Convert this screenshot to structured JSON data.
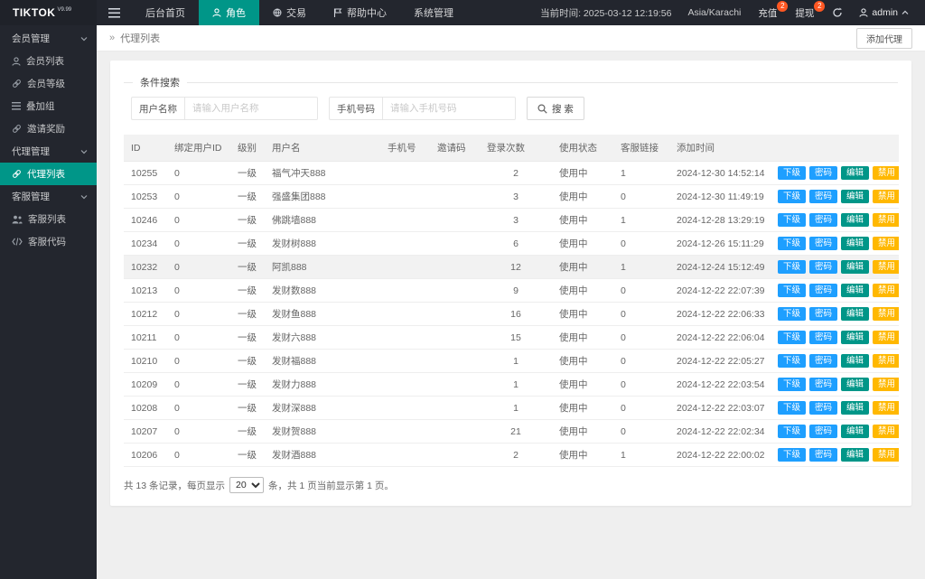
{
  "topbar": {
    "logo": "TIKTOK",
    "logo_version": "V9.99",
    "nav": [
      {
        "label": "后台首页"
      },
      {
        "label": "角色",
        "active": true
      },
      {
        "label": "交易"
      },
      {
        "label": "帮助中心"
      },
      {
        "label": "系统管理"
      }
    ],
    "time_label": "当前时间: 2025-03-12 12:19:56",
    "timezone": "Asia/Karachi",
    "recharge_label": "充值",
    "recharge_badge": "2",
    "withdraw_label": "提现",
    "withdraw_badge": "2",
    "username": "admin"
  },
  "sidebar": {
    "groups": [
      {
        "label": "会员管理",
        "items": [
          {
            "label": "会员列表",
            "icon": "person-icon"
          },
          {
            "label": "会员等级",
            "icon": "link-icon"
          },
          {
            "label": "叠加组",
            "icon": "list-icon"
          },
          {
            "label": "邀请奖励",
            "icon": "link-icon"
          }
        ]
      },
      {
        "label": "代理管理",
        "items": [
          {
            "label": "代理列表",
            "icon": "link-icon",
            "active": true
          }
        ]
      },
      {
        "label": "客服管理",
        "items": [
          {
            "label": "客服列表",
            "icon": "people-icon"
          },
          {
            "label": "客服代码",
            "icon": "code-icon"
          }
        ]
      }
    ]
  },
  "breadcrumb": {
    "separator": "»",
    "label": "代理列表"
  },
  "toolbar": {
    "add_button": "添加代理"
  },
  "search": {
    "legend": "条件搜索",
    "username_label": "用户名称",
    "username_placeholder": "请输入用户名称",
    "phone_label": "手机号码",
    "phone_placeholder": "请输入手机号码",
    "search_button": "搜 索"
  },
  "table": {
    "headers": [
      "ID",
      "绑定用户ID",
      "级别",
      "用户名",
      "手机号",
      "邀请码",
      "登录次数",
      "使用状态",
      "客服链接",
      "添加时间",
      ""
    ],
    "actions": [
      {
        "label": "下级",
        "name": "sublevel-button",
        "color": "#1E9FFF"
      },
      {
        "label": "密码",
        "name": "password-button",
        "color": "#1E9FFF"
      },
      {
        "label": "编辑",
        "name": "edit-button",
        "color": "#009688"
      },
      {
        "label": "禁用",
        "name": "disable-button",
        "color": "#FFB800"
      }
    ],
    "rows": [
      {
        "id": "10255",
        "bind_id": "0",
        "level": "一级",
        "username": "福气冲天888",
        "phone": "",
        "invite_code": "",
        "logins": "2",
        "status": "使用中",
        "cs_link": "1",
        "added": "2024-12-30 14:52:14",
        "highlight": false
      },
      {
        "id": "10253",
        "bind_id": "0",
        "level": "一级",
        "username": "强盛集团888",
        "phone": "",
        "invite_code": "",
        "logins": "3",
        "status": "使用中",
        "cs_link": "0",
        "added": "2024-12-30 11:49:19",
        "highlight": false
      },
      {
        "id": "10246",
        "bind_id": "0",
        "level": "一级",
        "username": "佛跳墙888",
        "phone": "",
        "invite_code": "",
        "logins": "3",
        "status": "使用中",
        "cs_link": "1",
        "added": "2024-12-28 13:29:19",
        "highlight": false
      },
      {
        "id": "10234",
        "bind_id": "0",
        "level": "一级",
        "username": "发财树888",
        "phone": "",
        "invite_code": "",
        "logins": "6",
        "status": "使用中",
        "cs_link": "0",
        "added": "2024-12-26 15:11:29",
        "highlight": false
      },
      {
        "id": "10232",
        "bind_id": "0",
        "level": "一级",
        "username": "阿凯888",
        "phone": "",
        "invite_code": "",
        "logins": "12",
        "status": "使用中",
        "cs_link": "1",
        "added": "2024-12-24 15:12:49",
        "highlight": true
      },
      {
        "id": "10213",
        "bind_id": "0",
        "level": "一级",
        "username": "发财数888",
        "phone": "",
        "invite_code": "",
        "logins": "9",
        "status": "使用中",
        "cs_link": "0",
        "added": "2024-12-22 22:07:39",
        "highlight": false
      },
      {
        "id": "10212",
        "bind_id": "0",
        "level": "一级",
        "username": "发财鱼888",
        "phone": "",
        "invite_code": "",
        "logins": "16",
        "status": "使用中",
        "cs_link": "0",
        "added": "2024-12-22 22:06:33",
        "highlight": false
      },
      {
        "id": "10211",
        "bind_id": "0",
        "level": "一级",
        "username": "发财六888",
        "phone": "",
        "invite_code": "",
        "logins": "15",
        "status": "使用中",
        "cs_link": "0",
        "added": "2024-12-22 22:06:04",
        "highlight": false
      },
      {
        "id": "10210",
        "bind_id": "0",
        "level": "一级",
        "username": "发财福888",
        "phone": "",
        "invite_code": "",
        "logins": "1",
        "status": "使用中",
        "cs_link": "0",
        "added": "2024-12-22 22:05:27",
        "highlight": false
      },
      {
        "id": "10209",
        "bind_id": "0",
        "level": "一级",
        "username": "发财力888",
        "phone": "",
        "invite_code": "",
        "logins": "1",
        "status": "使用中",
        "cs_link": "0",
        "added": "2024-12-22 22:03:54",
        "highlight": false
      },
      {
        "id": "10208",
        "bind_id": "0",
        "level": "一级",
        "username": "发财深888",
        "phone": "",
        "invite_code": "",
        "logins": "1",
        "status": "使用中",
        "cs_link": "0",
        "added": "2024-12-22 22:03:07",
        "highlight": false
      },
      {
        "id": "10207",
        "bind_id": "0",
        "level": "一级",
        "username": "发财贺888",
        "phone": "",
        "invite_code": "",
        "logins": "21",
        "status": "使用中",
        "cs_link": "0",
        "added": "2024-12-22 22:02:34",
        "highlight": false
      },
      {
        "id": "10206",
        "bind_id": "0",
        "level": "一级",
        "username": "发财酒888",
        "phone": "",
        "invite_code": "",
        "logins": "2",
        "status": "使用中",
        "cs_link": "1",
        "added": "2024-12-22 22:00:02",
        "highlight": false
      }
    ]
  },
  "pagination": {
    "text_before": "共 13 条记录，每页显示",
    "page_size": "20",
    "text_after": "条，共 1 页当前显示第 1 页。"
  },
  "colors": {
    "accent_teal": "#009688",
    "accent_blue": "#1E9FFF",
    "accent_orange": "#FFB800",
    "status_green": "#5FB878",
    "badge_red": "#FF5722",
    "dark_bg": "#23262E"
  }
}
